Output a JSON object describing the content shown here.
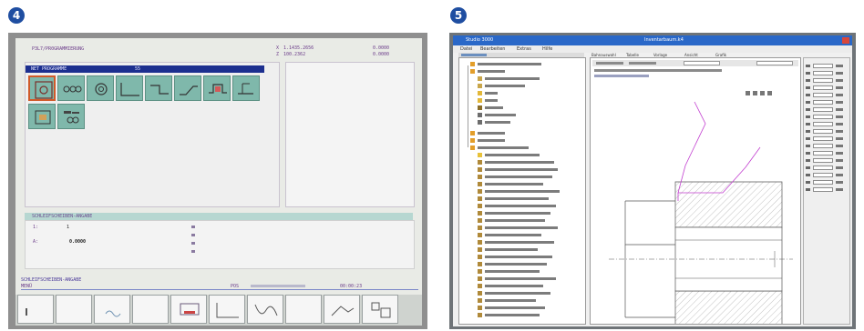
{
  "badges": {
    "left": "4",
    "right": "5"
  },
  "cnc": {
    "header_left": "P3L7/PR0GRAMMIERUNG",
    "coord_x_label": "X",
    "coord_x_value": "1.1435.2656",
    "coord_x_right": "0.0000",
    "coord_z_label": "Z",
    "coord_z_value": "100.2362",
    "coord_z_right": "0.0000",
    "ribbon_left": "NET PROGRAMME",
    "ribbon_right": "55",
    "mid_ribbon": "SCHLEIFSCHEIBEN-ANGABE",
    "field_a_label": "A:",
    "field_a_value": "0.0000",
    "field_b_label": "1:",
    "field_b_value": "1",
    "footer_ribbon": "SCHLEIFSCHEIBEN-ANGABE",
    "footer_label": "MENÜ",
    "footer_status": "POS",
    "footer_time": "00:00:23"
  },
  "cad": {
    "title_left": "Studio 3000",
    "title_right": "Inventarbaum.k4",
    "menu": [
      "Datei",
      "Bearbeiten",
      "Extras",
      "Hilfe"
    ],
    "tabs": [
      "Bahnauswahl",
      "Tabelle",
      "Vorlage",
      "Ansicht",
      "Grafik"
    ]
  }
}
